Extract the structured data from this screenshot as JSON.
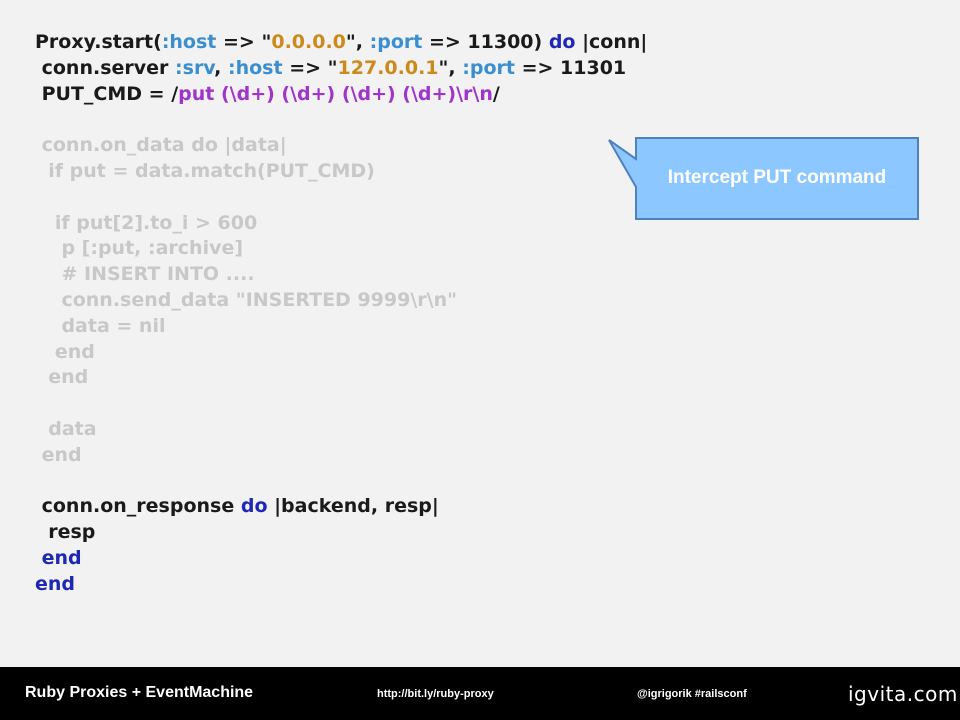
{
  "code": {
    "lines": [
      {
        "dim": false,
        "tokens": [
          {
            "t": "Proxy.start(",
            "c": "plain"
          },
          {
            "t": ":host",
            "c": "sym"
          },
          {
            "t": " => \"",
            "c": "plain"
          },
          {
            "t": "0.0.0.0",
            "c": "str"
          },
          {
            "t": "\", ",
            "c": "plain"
          },
          {
            "t": ":port",
            "c": "sym"
          },
          {
            "t": " => 11300) ",
            "c": "plain"
          },
          {
            "t": "do",
            "c": "kw"
          },
          {
            "t": " |conn|",
            "c": "plain"
          }
        ]
      },
      {
        "dim": false,
        "tokens": [
          {
            "t": " conn.server ",
            "c": "plain"
          },
          {
            "t": ":srv",
            "c": "sym"
          },
          {
            "t": ", ",
            "c": "plain"
          },
          {
            "t": ":host",
            "c": "sym"
          },
          {
            "t": " => \"",
            "c": "plain"
          },
          {
            "t": "127.0.0.1",
            "c": "str"
          },
          {
            "t": "\", ",
            "c": "plain"
          },
          {
            "t": ":port",
            "c": "sym"
          },
          {
            "t": " => 11301",
            "c": "plain"
          }
        ]
      },
      {
        "dim": false,
        "tokens": [
          {
            "t": " PUT_CMD = /",
            "c": "plain"
          },
          {
            "t": "put (\\d+) (\\d+) (\\d+) (\\d+)\\r\\n",
            "c": "re"
          },
          {
            "t": "/",
            "c": "plain"
          }
        ]
      },
      {
        "dim": false,
        "tokens": [
          {
            "t": "",
            "c": "plain"
          }
        ]
      },
      {
        "dim": true,
        "tokens": [
          {
            "t": " conn.on_data do |data|",
            "c": "plain"
          }
        ]
      },
      {
        "dim": true,
        "tokens": [
          {
            "t": "  if put = data.match(PUT_CMD)",
            "c": "plain"
          }
        ]
      },
      {
        "dim": false,
        "tokens": [
          {
            "t": "",
            "c": "plain"
          }
        ]
      },
      {
        "dim": true,
        "tokens": [
          {
            "t": "   if put[2].to_i > 600",
            "c": "plain"
          }
        ]
      },
      {
        "dim": true,
        "tokens": [
          {
            "t": "    p [:put, :archive]",
            "c": "plain"
          }
        ]
      },
      {
        "dim": true,
        "tokens": [
          {
            "t": "    # INSERT INTO ....",
            "c": "plain"
          }
        ]
      },
      {
        "dim": true,
        "tokens": [
          {
            "t": "    conn.send_data \"INSERTED 9999\\r\\n\"",
            "c": "plain"
          }
        ]
      },
      {
        "dim": true,
        "tokens": [
          {
            "t": "    data = nil",
            "c": "plain"
          }
        ]
      },
      {
        "dim": true,
        "tokens": [
          {
            "t": "   end",
            "c": "plain"
          }
        ]
      },
      {
        "dim": true,
        "tokens": [
          {
            "t": "  end",
            "c": "plain"
          }
        ]
      },
      {
        "dim": false,
        "tokens": [
          {
            "t": "",
            "c": "plain"
          }
        ]
      },
      {
        "dim": true,
        "tokens": [
          {
            "t": "  data",
            "c": "plain"
          }
        ]
      },
      {
        "dim": true,
        "tokens": [
          {
            "t": " end",
            "c": "plain"
          }
        ]
      },
      {
        "dim": false,
        "tokens": [
          {
            "t": "",
            "c": "plain"
          }
        ]
      },
      {
        "dim": false,
        "tokens": [
          {
            "t": " conn.on_response ",
            "c": "plain"
          },
          {
            "t": "do",
            "c": "kw"
          },
          {
            "t": " |backend, resp|",
            "c": "plain"
          }
        ]
      },
      {
        "dim": false,
        "tokens": [
          {
            "t": "  resp",
            "c": "plain"
          }
        ]
      },
      {
        "dim": false,
        "tokens": [
          {
            "t": " end",
            "c": "kw"
          }
        ]
      },
      {
        "dim": false,
        "tokens": [
          {
            "t": "end",
            "c": "kw"
          }
        ]
      }
    ]
  },
  "callout": {
    "text": "Intercept PUT command",
    "fill": "#8cc8ff",
    "stroke": "#4f81bd"
  },
  "footer": {
    "title": "Ruby Proxies + EventMachine",
    "url": "http://bit.ly/ruby-proxy",
    "handle": "@igrigorik #railsconf",
    "logo": "igvita.com"
  }
}
